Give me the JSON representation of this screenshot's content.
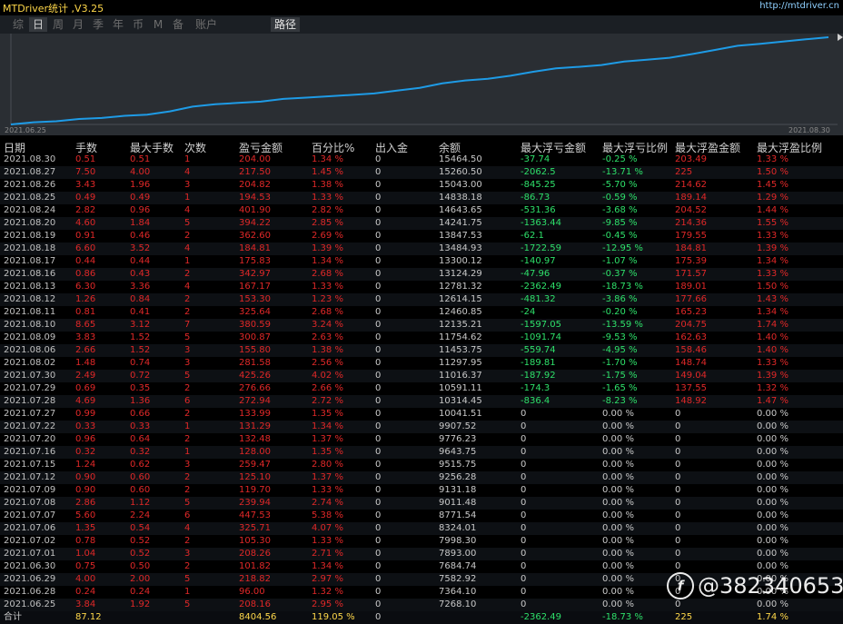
{
  "app": {
    "title": "MTDriver统计 ,V3.25",
    "link": "http://mtdriver.cn"
  },
  "tabs": [
    "综",
    "日",
    "周",
    "月",
    "季",
    "年",
    "币",
    "M",
    "备",
    "账户"
  ],
  "active_tab": "日",
  "route_tab": "路径",
  "chart": {
    "start_date": "2021.06.25",
    "end_date": "2021.08.30",
    "line_color": "#1e9be6"
  },
  "columns": [
    "日期",
    "手数",
    "最大手数",
    "次数",
    "盈亏金额",
    "百分比%",
    "出入金",
    "余额",
    "最大浮亏金额",
    "最大浮亏比例",
    "最大浮盈金额",
    "最大浮盈比例"
  ],
  "rows": [
    [
      "2021.08.30",
      "0.51",
      "0.51",
      "1",
      "204.00",
      "1.34 %",
      "0",
      "15464.50",
      "-37.74",
      "-0.25 %",
      "203.49",
      "1.33 %"
    ],
    [
      "2021.08.27",
      "7.50",
      "4.00",
      "4",
      "217.50",
      "1.45 %",
      "0",
      "15260.50",
      "-2062.5",
      "-13.71 %",
      "225",
      "1.50 %"
    ],
    [
      "2021.08.26",
      "3.43",
      "1.96",
      "3",
      "204.82",
      "1.38 %",
      "0",
      "15043.00",
      "-845.25",
      "-5.70 %",
      "214.62",
      "1.45 %"
    ],
    [
      "2021.08.25",
      "0.49",
      "0.49",
      "1",
      "194.53",
      "1.33 %",
      "0",
      "14838.18",
      "-86.73",
      "-0.59 %",
      "189.14",
      "1.29 %"
    ],
    [
      "2021.08.24",
      "2.82",
      "0.96",
      "4",
      "401.90",
      "2.82 %",
      "0",
      "14643.65",
      "-531.36",
      "-3.68 %",
      "204.52",
      "1.44 %"
    ],
    [
      "2021.08.20",
      "4.60",
      "1.84",
      "5",
      "394.22",
      "2.85 %",
      "0",
      "14241.75",
      "-1363.44",
      "-9.85 %",
      "214.36",
      "1.55 %"
    ],
    [
      "2021.08.19",
      "0.91",
      "0.46",
      "2",
      "362.60",
      "2.69 %",
      "0",
      "13847.53",
      "-62.1",
      "-0.45 %",
      "179.55",
      "1.33 %"
    ],
    [
      "2021.08.18",
      "6.60",
      "3.52",
      "4",
      "184.81",
      "1.39 %",
      "0",
      "13484.93",
      "-1722.59",
      "-12.95 %",
      "184.81",
      "1.39 %"
    ],
    [
      "2021.08.17",
      "0.44",
      "0.44",
      "1",
      "175.83",
      "1.34 %",
      "0",
      "13300.12",
      "-140.97",
      "-1.07 %",
      "175.39",
      "1.34 %"
    ],
    [
      "2021.08.16",
      "0.86",
      "0.43",
      "2",
      "342.97",
      "2.68 %",
      "0",
      "13124.29",
      "-47.96",
      "-0.37 %",
      "171.57",
      "1.33 %"
    ],
    [
      "2021.08.13",
      "6.30",
      "3.36",
      "4",
      "167.17",
      "1.33 %",
      "0",
      "12781.32",
      "-2362.49",
      "-18.73 %",
      "189.01",
      "1.50 %"
    ],
    [
      "2021.08.12",
      "1.26",
      "0.84",
      "2",
      "153.30",
      "1.23 %",
      "0",
      "12614.15",
      "-481.32",
      "-3.86 %",
      "177.66",
      "1.43 %"
    ],
    [
      "2021.08.11",
      "0.81",
      "0.41",
      "2",
      "325.64",
      "2.68 %",
      "0",
      "12460.85",
      "-24",
      "-0.20 %",
      "165.23",
      "1.34 %"
    ],
    [
      "2021.08.10",
      "8.65",
      "3.12",
      "7",
      "380.59",
      "3.24 %",
      "0",
      "12135.21",
      "-1597.05",
      "-13.59 %",
      "204.75",
      "1.74 %"
    ],
    [
      "2021.08.09",
      "3.83",
      "1.52",
      "5",
      "300.87",
      "2.63 %",
      "0",
      "11754.62",
      "-1091.74",
      "-9.53 %",
      "162.63",
      "1.40 %"
    ],
    [
      "2021.08.06",
      "2.66",
      "1.52",
      "3",
      "155.80",
      "1.38 %",
      "0",
      "11453.75",
      "-559.74",
      "-4.95 %",
      "158.46",
      "1.40 %"
    ],
    [
      "2021.08.02",
      "1.48",
      "0.74",
      "3",
      "281.58",
      "2.56 %",
      "0",
      "11297.95",
      "-189.81",
      "-1.70 %",
      "148.74",
      "1.33 %"
    ],
    [
      "2021.07.30",
      "2.49",
      "0.72",
      "5",
      "425.26",
      "4.02 %",
      "0",
      "11016.37",
      "-187.92",
      "-1.75 %",
      "149.04",
      "1.39 %"
    ],
    [
      "2021.07.29",
      "0.69",
      "0.35",
      "2",
      "276.66",
      "2.66 %",
      "0",
      "10591.11",
      "-174.3",
      "-1.65 %",
      "137.55",
      "1.32 %"
    ],
    [
      "2021.07.28",
      "4.69",
      "1.36",
      "6",
      "272.94",
      "2.72 %",
      "0",
      "10314.45",
      "-836.4",
      "-8.23 %",
      "148.92",
      "1.47 %"
    ],
    [
      "2021.07.27",
      "0.99",
      "0.66",
      "2",
      "133.99",
      "1.35 %",
      "0",
      "10041.51",
      "0",
      "0.00 %",
      "0",
      "0.00 %"
    ],
    [
      "2021.07.22",
      "0.33",
      "0.33",
      "1",
      "131.29",
      "1.34 %",
      "0",
      "9907.52",
      "0",
      "0.00 %",
      "0",
      "0.00 %"
    ],
    [
      "2021.07.20",
      "0.96",
      "0.64",
      "2",
      "132.48",
      "1.37 %",
      "0",
      "9776.23",
      "0",
      "0.00 %",
      "0",
      "0.00 %"
    ],
    [
      "2021.07.16",
      "0.32",
      "0.32",
      "1",
      "128.00",
      "1.35 %",
      "0",
      "9643.75",
      "0",
      "0.00 %",
      "0",
      "0.00 %"
    ],
    [
      "2021.07.15",
      "1.24",
      "0.62",
      "3",
      "259.47",
      "2.80 %",
      "0",
      "9515.75",
      "0",
      "0.00 %",
      "0",
      "0.00 %"
    ],
    [
      "2021.07.12",
      "0.90",
      "0.60",
      "2",
      "125.10",
      "1.37 %",
      "0",
      "9256.28",
      "0",
      "0.00 %",
      "0",
      "0.00 %"
    ],
    [
      "2021.07.09",
      "0.90",
      "0.60",
      "2",
      "119.70",
      "1.33 %",
      "0",
      "9131.18",
      "0",
      "0.00 %",
      "0",
      "0.00 %"
    ],
    [
      "2021.07.08",
      "2.86",
      "1.12",
      "5",
      "239.94",
      "2.74 %",
      "0",
      "9011.48",
      "0",
      "0.00 %",
      "0",
      "0.00 %"
    ],
    [
      "2021.07.07",
      "5.60",
      "2.24",
      "6",
      "447.53",
      "5.38 %",
      "0",
      "8771.54",
      "0",
      "0.00 %",
      "0",
      "0.00 %"
    ],
    [
      "2021.07.06",
      "1.35",
      "0.54",
      "4",
      "325.71",
      "4.07 %",
      "0",
      "8324.01",
      "0",
      "0.00 %",
      "0",
      "0.00 %"
    ],
    [
      "2021.07.02",
      "0.78",
      "0.52",
      "2",
      "105.30",
      "1.33 %",
      "0",
      "7998.30",
      "0",
      "0.00 %",
      "0",
      "0.00 %"
    ],
    [
      "2021.07.01",
      "1.04",
      "0.52",
      "3",
      "208.26",
      "2.71 %",
      "0",
      "7893.00",
      "0",
      "0.00 %",
      "0",
      "0.00 %"
    ],
    [
      "2021.06.30",
      "0.75",
      "0.50",
      "2",
      "101.82",
      "1.34 %",
      "0",
      "7684.74",
      "0",
      "0.00 %",
      "0",
      "0.00 %"
    ],
    [
      "2021.06.29",
      "4.00",
      "2.00",
      "5",
      "218.82",
      "2.97 %",
      "0",
      "7582.92",
      "0",
      "0.00 %",
      "0",
      "0.00 %"
    ],
    [
      "2021.06.28",
      "0.24",
      "0.24",
      "1",
      "96.00",
      "1.32 %",
      "0",
      "7364.10",
      "0",
      "0.00 %",
      "0",
      "0.00 %"
    ],
    [
      "2021.06.25",
      "3.84",
      "1.92",
      "5",
      "208.16",
      "2.95 %",
      "0",
      "7268.10",
      "0",
      "0.00 %",
      "0",
      "0.00 %"
    ]
  ],
  "total": [
    "合计",
    "87.12",
    "",
    "",
    "8404.56",
    "119.05 %",
    "0",
    "",
    "-2362.49",
    "-18.73 %",
    "225",
    "1.74 %"
  ],
  "watermark": {
    "text": "@382340653"
  }
}
